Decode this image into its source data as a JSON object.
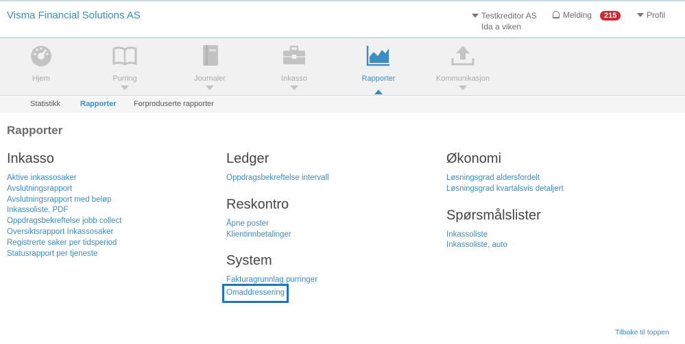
{
  "header": {
    "brand": "Visma Financial Solutions AS",
    "account_name": "Testkreditor AS",
    "account_user": "Ida a viken",
    "melding_label": "Melding",
    "melding_count": "215",
    "profil_label": "Profil"
  },
  "nav": {
    "items": [
      {
        "label": "Hjem",
        "icon": "dashboard-icon"
      },
      {
        "label": "Purring",
        "icon": "book-icon"
      },
      {
        "label": "Journaler",
        "icon": "journal-icon"
      },
      {
        "label": "Inkasso",
        "icon": "briefcase-icon"
      },
      {
        "label": "Rapporter",
        "icon": "chart-icon"
      },
      {
        "label": "Kommunikasjon",
        "icon": "upload-icon"
      }
    ],
    "active": "Rapporter"
  },
  "subnav": {
    "tabs": [
      "Statistikk",
      "Rapporter",
      "Forproduserte rapporter"
    ],
    "active": "Rapporter"
  },
  "page": {
    "title": "Rapporter"
  },
  "sections": {
    "inkasso": {
      "title": "Inkasso",
      "links": [
        "Aktive inkassosaker",
        "Avslutningsrapport",
        "Avslutningsrapport med beløp",
        "Inkassoliste, PDF",
        "Oppdragsbekreftelse jobb collect",
        "Oversiktsrapport Inkassosaker",
        "Registrerte saker per tidsperiod",
        "Statusrapport per tjeneste"
      ]
    },
    "ledger": {
      "title": "Ledger",
      "links": [
        "Oppdragsbekreftelse intervall"
      ]
    },
    "reskontro": {
      "title": "Reskontro",
      "links": [
        "Åpne poster",
        "Klientinnbetalinger"
      ]
    },
    "system": {
      "title": "System",
      "links": [
        "Fakturagrunnlag purringer",
        "Omaddressering"
      ]
    },
    "okonomi": {
      "title": "Økonomi",
      "links": [
        "Løsningsgrad aldersfordelt",
        "Løsningsgrad kvartalsvis detaljert"
      ]
    },
    "sporsmalslister": {
      "title": "Spørsmålslister",
      "links": [
        "Inkassoliste",
        "Inkassoliste, auto"
      ]
    }
  },
  "footer": {
    "back_to_top": "Tilbake til toppen"
  },
  "colors": {
    "accent": "#3c8dc4",
    "badge": "#d3262f",
    "focus_outline": "#1a73c7"
  }
}
